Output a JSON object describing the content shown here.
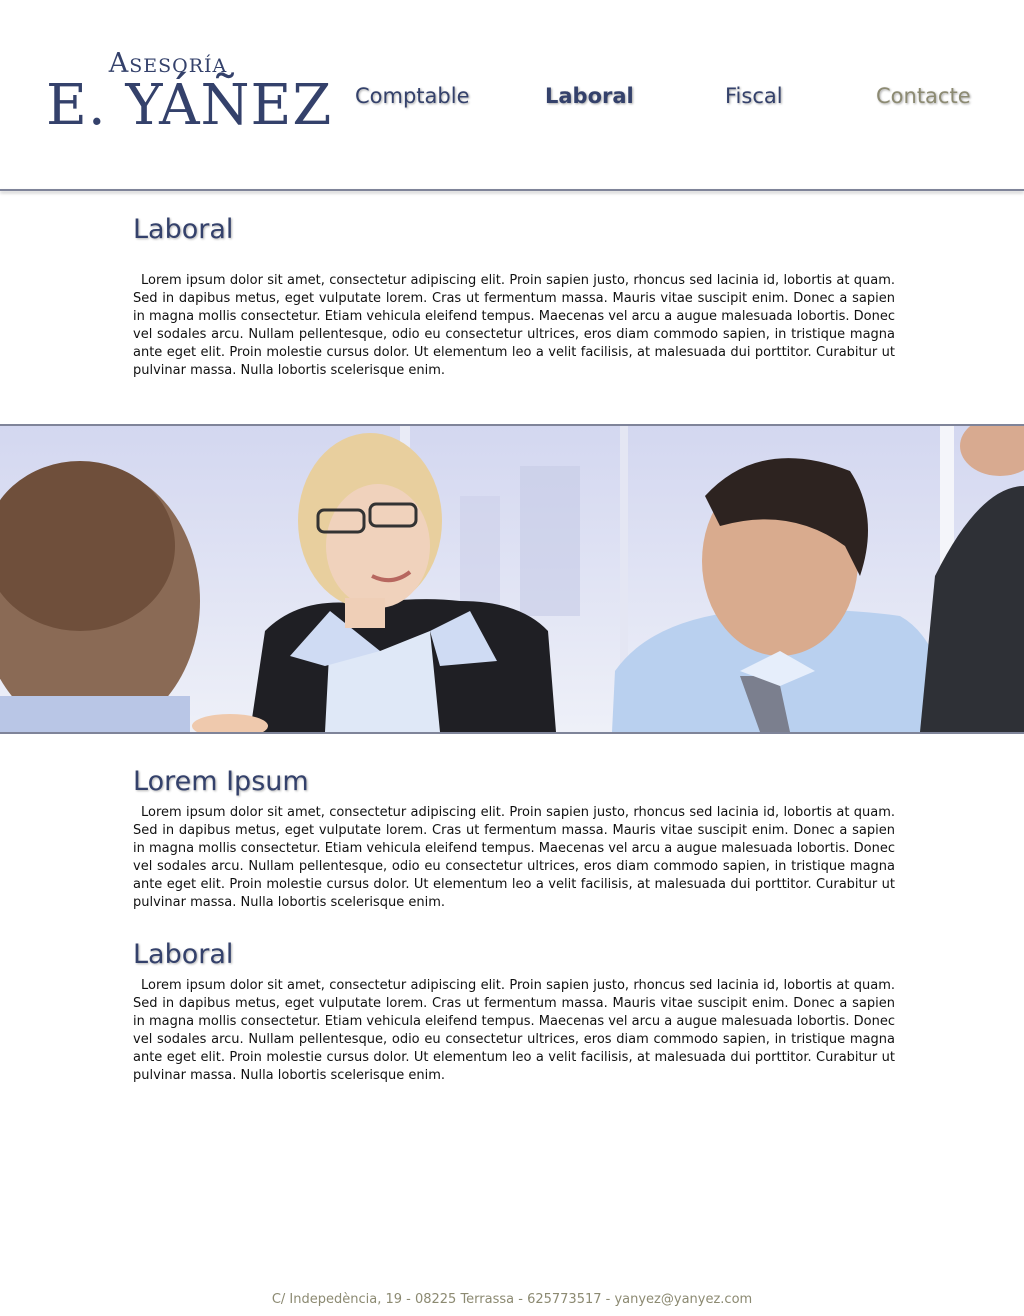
{
  "logo": {
    "top": "Asesoría",
    "main": "E. YÁÑEZ"
  },
  "nav": {
    "comptable": "Comptable",
    "laboral": "Laboral",
    "fiscal": "Fiscal",
    "contacte": "Contacte"
  },
  "sections": [
    {
      "title": "Laboral",
      "text": "Lorem ipsum dolor sit amet, consectetur adipiscing elit. Proin sapien justo, rhoncus sed lacinia id, lobortis at quam. Sed in dapibus metus, eget vulputate lorem. Cras ut fermentum massa. Mauris vitae suscipit enim. Donec a sapien in magna mollis consectetur. Etiam vehicula eleifend tempus. Maecenas vel arcu a augue malesuada lobortis. Donec vel sodales arcu. Nullam pellentesque, odio eu consectetur ultrices, eros diam commodo sapien, in tristique magna ante eget elit. Proin molestie cursus dolor. Ut elementum leo a velit facilisis, at malesuada dui porttitor. Curabitur ut pulvinar massa. Nulla lobortis scelerisque enim."
    },
    {
      "title": "Lorem Ipsum",
      "text": "Lorem ipsum dolor sit amet, consectetur adipiscing elit. Proin sapien justo, rhoncus sed lacinia id, lobortis at quam. Sed in dapibus metus, eget vulputate lorem. Cras ut fermentum massa. Mauris vitae suscipit enim. Donec a sapien in magna mollis consectetur. Etiam vehicula eleifend tempus. Maecenas vel arcu a augue malesuada lobortis. Donec vel sodales arcu. Nullam pellentesque, odio eu consectetur ultrices, eros diam commodo sapien, in tristique magna ante eget elit. Proin molestie cursus dolor. Ut elementum leo a velit facilisis, at malesuada dui porttitor. Curabitur ut pulvinar massa. Nulla lobortis scelerisque enim."
    },
    {
      "title": "Laboral",
      "text": "Lorem ipsum dolor sit amet, consectetur adipiscing elit. Proin sapien justo, rhoncus sed lacinia id, lobortis at quam. Sed in dapibus metus, eget vulputate lorem. Cras ut fermentum massa. Mauris vitae suscipit enim. Donec a sapien in magna mollis consectetur. Etiam vehicula eleifend tempus. Maecenas vel arcu a augue malesuada lobortis. Donec vel sodales arcu. Nullam pellentesque, odio eu consectetur ultrices, eros diam commodo sapien, in tristique magna ante eget elit. Proin molestie cursus dolor. Ut elementum leo a velit facilisis, at malesuada dui porttitor. Curabitur ut pulvinar massa. Nulla lobortis scelerisque enim."
    }
  ],
  "footer": "C/ Indepedència, 19 - 08225 Terrassa - 625773517 -  yanyez@yanyez.com",
  "colors": {
    "brand": "#34416b",
    "accent": "#8c8a72",
    "rule": "#7f8499"
  }
}
